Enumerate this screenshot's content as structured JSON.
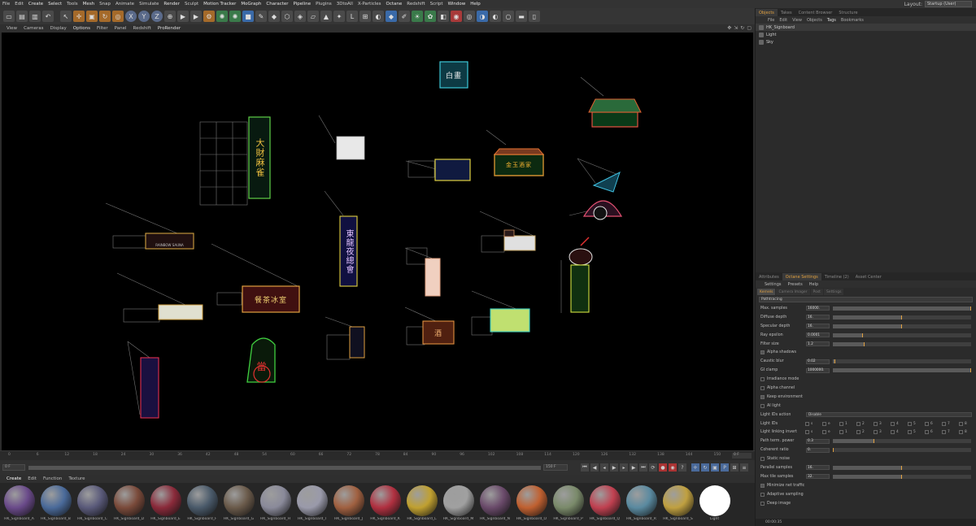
{
  "menu": [
    "File",
    "Edit",
    "Create",
    "Select",
    "Tools",
    "Mesh",
    "Snap",
    "Animate",
    "Simulate",
    "Render",
    "Sculpt",
    "Motion Tracker",
    "MoGraph",
    "Character",
    "Pipeline",
    "Plugins",
    "3DtoAll",
    "X-Particles",
    "Octane",
    "Redshift",
    "Script",
    "Window",
    "Help"
  ],
  "layout": {
    "label": "Layout:",
    "value": "Startup (User)"
  },
  "viewport_menu": [
    "View",
    "Cameras",
    "Display",
    "Options",
    "Filter",
    "Panel",
    "Redshift",
    "ProRender"
  ],
  "signs": {
    "s1": "白畫",
    "s2": "大財麻雀",
    "s3": "金玉酒家",
    "s4": "東龍夜總會",
    "s5": "餐茶冰室",
    "s6": "當",
    "s7": "RAINBOW SAUNA",
    "s8": "酒"
  },
  "timeline": {
    "ticks": [
      "0",
      "6",
      "12",
      "18",
      "24",
      "30",
      "36",
      "42",
      "48",
      "54",
      "60",
      "66",
      "72",
      "78",
      "84",
      "90",
      "96",
      "102",
      "108",
      "114",
      "120",
      "126",
      "132",
      "138",
      "144",
      "150"
    ],
    "end_frame": "0 F",
    "start_field": "0 F",
    "end_field": "150 F"
  },
  "material_menu": [
    "Create",
    "Edit",
    "Function",
    "Texture"
  ],
  "materials": [
    {
      "name": "HK_Signboard_A",
      "color": "#6a4a8a"
    },
    {
      "name": "HK_Signboard_B",
      "color": "#4a6a9a"
    },
    {
      "name": "HK_Signboard_C",
      "color": "#5a5a7a"
    },
    {
      "name": "HK_Signboard_D",
      "color": "#7a4a3a"
    },
    {
      "name": "HK_Signboard_E",
      "color": "#8a2a3a"
    },
    {
      "name": "HK_Signboard_F",
      "color": "#4a5a6a"
    },
    {
      "name": "HK_Signboard_G",
      "color": "#6a5a4a"
    },
    {
      "name": "HK_Signboard_H",
      "color": "#8a8a9a"
    },
    {
      "name": "HK_Signboard_I",
      "color": "#9a9aaa"
    },
    {
      "name": "HK_Signboard_J",
      "color": "#a06040"
    },
    {
      "name": "HK_Signboard_K",
      "color": "#b03040"
    },
    {
      "name": "HK_Signboard_L",
      "color": "#c0a030"
    },
    {
      "name": "HK_Signboard_M",
      "color": "#a0a0a0"
    },
    {
      "name": "HK_Signboard_N",
      "color": "#6a4a6a"
    },
    {
      "name": "HK_Signboard_O",
      "color": "#c06030"
    },
    {
      "name": "HK_Signboard_P",
      "color": "#7a8a6a"
    },
    {
      "name": "HK_Signboard_Q",
      "color": "#c04050"
    },
    {
      "name": "HK_Signboard_R",
      "color": "#5a8aa0"
    },
    {
      "name": "HK_Signboard_S",
      "color": "#c0a040"
    },
    {
      "name": "Light",
      "color": "#ffffff"
    }
  ],
  "right": {
    "top_tabs": [
      "Objects",
      "Takes",
      "Content Browser",
      "Structure"
    ],
    "object_menu": [
      "File",
      "Edit",
      "View",
      "Objects",
      "Tags",
      "Bookmarks"
    ],
    "objects": [
      "HK_Signboard",
      "Light",
      "Sky"
    ],
    "attr_tabs": [
      "Attributes",
      "Octane Settings",
      "Timeline (2)",
      "Asset Center"
    ],
    "attr_menu": [
      "Settings",
      "Presets",
      "Help"
    ],
    "sub_tabs": [
      "Kernels",
      "Camera Imager",
      "Post",
      "Settings"
    ],
    "kernel": "Pathtracing",
    "params": [
      {
        "label": "Max. samples",
        "value": "16000.",
        "fill": 1.0
      },
      {
        "label": "Diffuse depth",
        "value": "16.",
        "fill": 0.5
      },
      {
        "label": "Specular depth",
        "value": "16.",
        "fill": 0.5
      },
      {
        "label": "Ray epsilon",
        "value": "0.0001",
        "fill": 0.22
      },
      {
        "label": "Filter size",
        "value": "1.2",
        "fill": 0.23
      },
      {
        "label": "Alpha shadows",
        "check": true
      },
      {
        "label": "Caustic blur",
        "value": "0.02",
        "fill": 0.02
      },
      {
        "label": "GI clamp",
        "value": "1000000.",
        "fill": 1.0
      },
      {
        "label": "Irradiance mode",
        "check": false
      },
      {
        "label": "Alpha channel",
        "check": false
      },
      {
        "label": "Keep environment",
        "check": true
      },
      {
        "label": "AI light",
        "check": false
      },
      {
        "label": "Light IDs action",
        "dropdown": "Disable"
      },
      {
        "label": "Light IDs",
        "ids": [
          "s",
          "e",
          "1",
          "2",
          "3",
          "4",
          "5",
          "6",
          "7",
          "8"
        ]
      },
      {
        "label": "Light linking invert",
        "ids": [
          "s",
          "e",
          "1",
          "2",
          "3",
          "4",
          "5",
          "6",
          "7",
          "8"
        ]
      },
      {
        "label": "Path term. power",
        "value": "0.3",
        "fill": 0.3
      },
      {
        "label": "Coherent ratio",
        "value": "0.",
        "fill": 0.0
      },
      {
        "label": "Static noise",
        "check": false
      },
      {
        "label": "Parallel samples",
        "value": "16.",
        "fill": 0.5
      },
      {
        "label": "Max tile samples",
        "value": "32.",
        "fill": 0.5
      },
      {
        "label": "Minimize net traffic",
        "check": true
      },
      {
        "label": "Adaptive sampling",
        "check": false
      },
      {
        "label": "Deep image",
        "check": false
      }
    ],
    "status": "00:00:35"
  }
}
